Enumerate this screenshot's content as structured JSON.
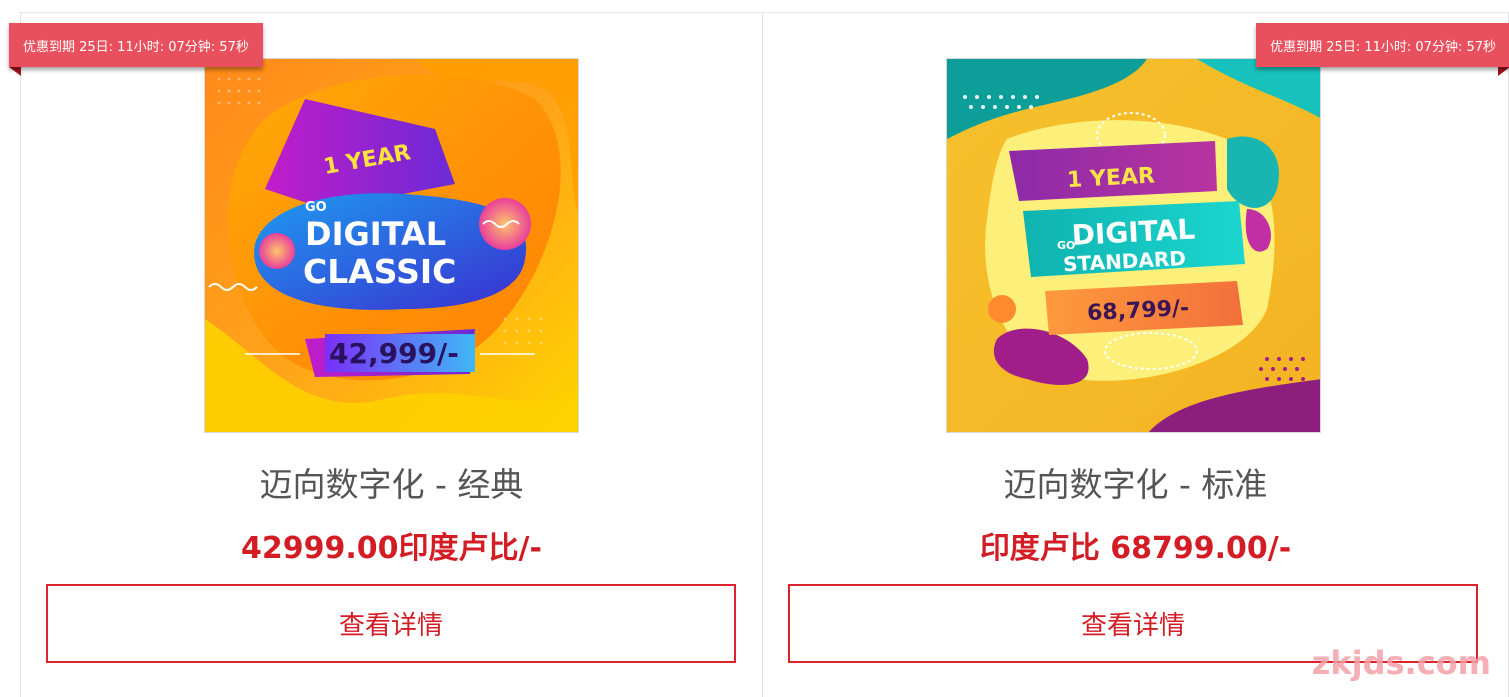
{
  "products": [
    {
      "countdown": "优惠到期 25日:  11小时:  07分钟:  57秒",
      "title": "迈向数字化 - 经典",
      "price": "42999.00印度卢比/-",
      "button_label": "查看详情",
      "image": {
        "line1": "1 YEAR",
        "line2": "GO",
        "line3": "DIGITAL",
        "line4": "CLASSIC",
        "price_tag": "42,999/-"
      }
    },
    {
      "countdown": "优惠到期 25日:  11小时:  07分钟:  57秒",
      "title": "迈向数字化 - 标准",
      "price": "印度卢比 68799.00/-",
      "button_label": "查看详情",
      "image": {
        "line1": "1 YEAR",
        "line2": "GO",
        "line3": "DIGITAL",
        "line4": "STANDARD",
        "price_tag": "68,799/-"
      }
    }
  ],
  "watermark": "zkjds.com",
  "colors": {
    "accent_red": "#d31d25",
    "ribbon": "#e9505d"
  }
}
